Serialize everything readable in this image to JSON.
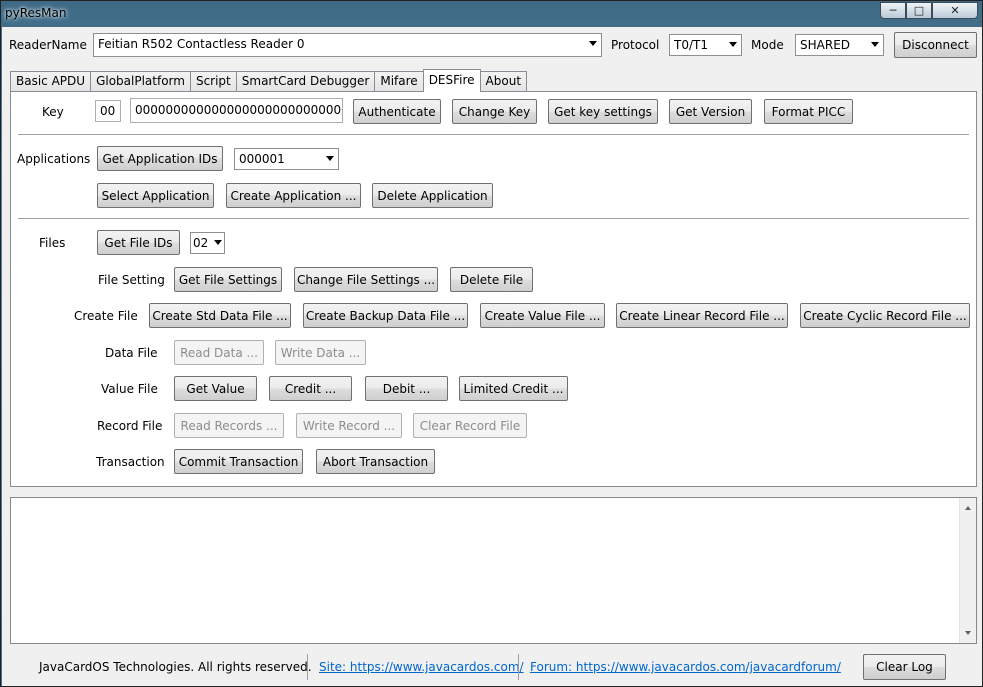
{
  "window": {
    "title": "pyResMan"
  },
  "top_bar": {
    "reader_label": "ReaderName",
    "reader_value": "Feitian R502 Contactless Reader 0",
    "protocol_label": "Protocol",
    "protocol_value": "T0/T1",
    "mode_label": "Mode",
    "mode_value": "SHARED",
    "disconnect_label": "Disconnect"
  },
  "tabs": [
    {
      "label": "Basic APDU"
    },
    {
      "label": "GlobalPlatform"
    },
    {
      "label": "Script"
    },
    {
      "label": "SmartCard Debugger"
    },
    {
      "label": "Mifare"
    },
    {
      "label": "DESFire"
    },
    {
      "label": "About"
    }
  ],
  "desfire": {
    "key_label": "Key",
    "key_no": "00",
    "key_value": "00000000000000000000000000000000",
    "authenticate": "Authenticate",
    "change_key": "Change Key",
    "get_key_settings": "Get key settings",
    "get_version": "Get Version",
    "format_picc": "Format PICC",
    "applications_label": "Applications",
    "get_app_ids": "Get Application IDs",
    "app_id_value": "000001",
    "select_app": "Select Application",
    "create_app": "Create Application ...",
    "delete_app": "Delete Application",
    "files_label": "Files",
    "get_file_ids": "Get File IDs",
    "file_id_value": "02",
    "file_setting_label": "File Setting",
    "get_file_settings": "Get File Settings",
    "change_file_settings": "Change File Settings ...",
    "delete_file": "Delete File",
    "create_file_label": "Create File",
    "create_std": "Create Std Data File ...",
    "create_backup": "Create Backup Data File ...",
    "create_value": "Create Value File ...",
    "create_linear": "Create Linear Record File ...",
    "create_cyclic": "Create Cyclic Record File ...",
    "data_file_label": "Data File",
    "read_data": "Read Data ...",
    "write_data": "Write Data ...",
    "value_file_label": "Value File",
    "get_value": "Get Value",
    "credit": "Credit ...",
    "debit": "Debit ...",
    "limited_credit": "Limited Credit ...",
    "record_file_label": "Record File",
    "read_records": "Read Records ...",
    "write_record": "Write Record ...",
    "clear_record": "Clear Record File",
    "transaction_label": "Transaction",
    "commit": "Commit Transaction",
    "abort": "Abort Transaction"
  },
  "log": {
    "text": ""
  },
  "status": {
    "copyright": "JavaCardOS Technologies. All rights reserved.",
    "site_link": "Site: https://www.javacardos.com/",
    "forum_link": "Forum: https://www.javacardos.com/javacardforum/",
    "clear_log": "Clear Log"
  }
}
